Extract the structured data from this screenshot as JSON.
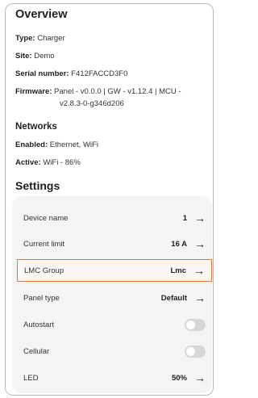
{
  "overview": {
    "title": "Overview",
    "type_label": "Type:",
    "type_value": "Charger",
    "site_label": "Site:",
    "site_value": "Demo",
    "serial_label": "Serial number:",
    "serial_value": "F412FACCD3F0",
    "firmware_label": "Firmware:",
    "firmware_value_line1": "Panel - v0.0.0 | GW - v1.12.4 | MCU -",
    "firmware_value_line2": "v2.8.3-0-g346d206"
  },
  "networks": {
    "title": "Networks",
    "enabled_label": "Enabled:",
    "enabled_value": "Ethernet, WiFi",
    "active_label": "Active:",
    "active_value": "WiFi - 86%"
  },
  "settings": {
    "title": "Settings",
    "rows": [
      {
        "label": "Device name",
        "value": "1",
        "control": "arrow"
      },
      {
        "label": "Current limit",
        "value": "16 A",
        "control": "arrow"
      },
      {
        "label": "LMC Group",
        "value": "Lmc",
        "control": "arrow"
      },
      {
        "label": "Panel type",
        "value": "Default",
        "control": "arrow"
      },
      {
        "label": "Autostart",
        "value": "",
        "control": "toggle",
        "on": false
      },
      {
        "label": "Cellular",
        "value": "",
        "control": "toggle",
        "on": false
      },
      {
        "label": "LED",
        "value": "50%",
        "control": "arrow"
      }
    ],
    "arrow_icon": "→",
    "highlight_color": "#e1743d"
  }
}
